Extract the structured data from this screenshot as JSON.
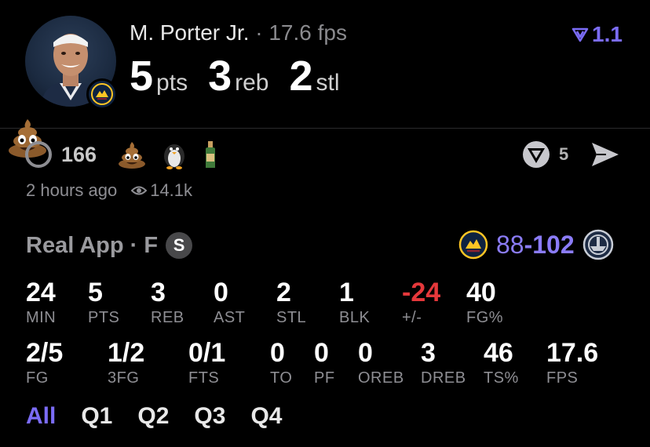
{
  "player": {
    "name": "M. Porter Jr.",
    "separator": "·",
    "fps_text": "17.6 fps",
    "avatar_icon": "player-headshot",
    "team_logo_icon": "nuggets-logo"
  },
  "headline": {
    "pts_value": "5",
    "pts_label": "pts",
    "reb_value": "3",
    "reb_label": "reb",
    "stl_value": "2",
    "stl_label": "stl"
  },
  "rating": {
    "icon": "trend-chevron-icon",
    "value": "1.1",
    "color": "#7b6cf6"
  },
  "reactions": {
    "count": "166",
    "emojis": [
      "poop-emoji",
      "penguin-emoji",
      "bottle-emoji"
    ],
    "share_count": "5"
  },
  "meta": {
    "time_ago": "2 hours ago",
    "views": "14.1k"
  },
  "game": {
    "label": "Real App · F",
    "status_badge": "S",
    "team_score": "88",
    "dash": "-",
    "opp_score": "102",
    "opp_logo_icon": "opponent-logo"
  },
  "stats_row1": [
    {
      "value": "24",
      "label": "MIN"
    },
    {
      "value": "5",
      "label": "PTS"
    },
    {
      "value": "3",
      "label": "REB"
    },
    {
      "value": "0",
      "label": "AST"
    },
    {
      "value": "2",
      "label": "STL"
    },
    {
      "value": "1",
      "label": "BLK"
    },
    {
      "value": "-24",
      "label": "+/-"
    },
    {
      "value": "40",
      "label": "FG%"
    }
  ],
  "stats_row2": [
    {
      "value": "2/5",
      "label": "FG"
    },
    {
      "value": "1/2",
      "label": "3FG"
    },
    {
      "value": "0/1",
      "label": "FTS"
    },
    {
      "value": "0",
      "label": "TO"
    },
    {
      "value": "0",
      "label": "PF"
    },
    {
      "value": "0",
      "label": "OREB"
    },
    {
      "value": "3",
      "label": "DREB"
    },
    {
      "value": "46",
      "label": "TS%"
    },
    {
      "value": "17.6",
      "label": "FPS"
    }
  ],
  "tabs": [
    "All",
    "Q1",
    "Q2",
    "Q3",
    "Q4"
  ],
  "colors": {
    "accent": "#7b6cf6",
    "negative": "#e5383b",
    "muted": "#8e8e93"
  }
}
